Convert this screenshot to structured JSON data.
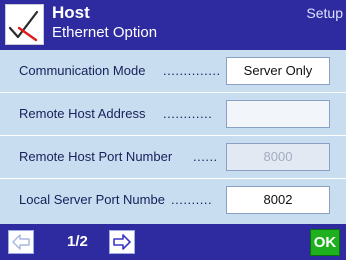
{
  "header": {
    "title": "Host",
    "subtitle": "Ethernet Option",
    "section": "Setup",
    "icon": "checkmark-cross-icon"
  },
  "rows": [
    {
      "label": "Communication Mode",
      "dots": "..............",
      "value": "Server Only",
      "state": "active"
    },
    {
      "label": "Remote Host Address",
      "dots": "............",
      "value": "",
      "state": "active"
    },
    {
      "label": "Remote Host Port Number",
      "dots": "......",
      "value": "8000",
      "state": "disabled"
    },
    {
      "label": "Local Server Port Numbe",
      "dots": "..........",
      "value": "8002",
      "state": "active"
    }
  ],
  "footer": {
    "page": "1/2",
    "ok_label": "OK",
    "prev_icon": "arrow-left-icon",
    "next_icon": "arrow-right-icon"
  },
  "colors": {
    "header_bg": "#2e2ba0",
    "panel_bg": "#c9ddf0",
    "ok_bg": "#1fb01f",
    "nav_arrow_active": "#3a37c8",
    "nav_arrow_inactive": "#a9b9e0"
  }
}
